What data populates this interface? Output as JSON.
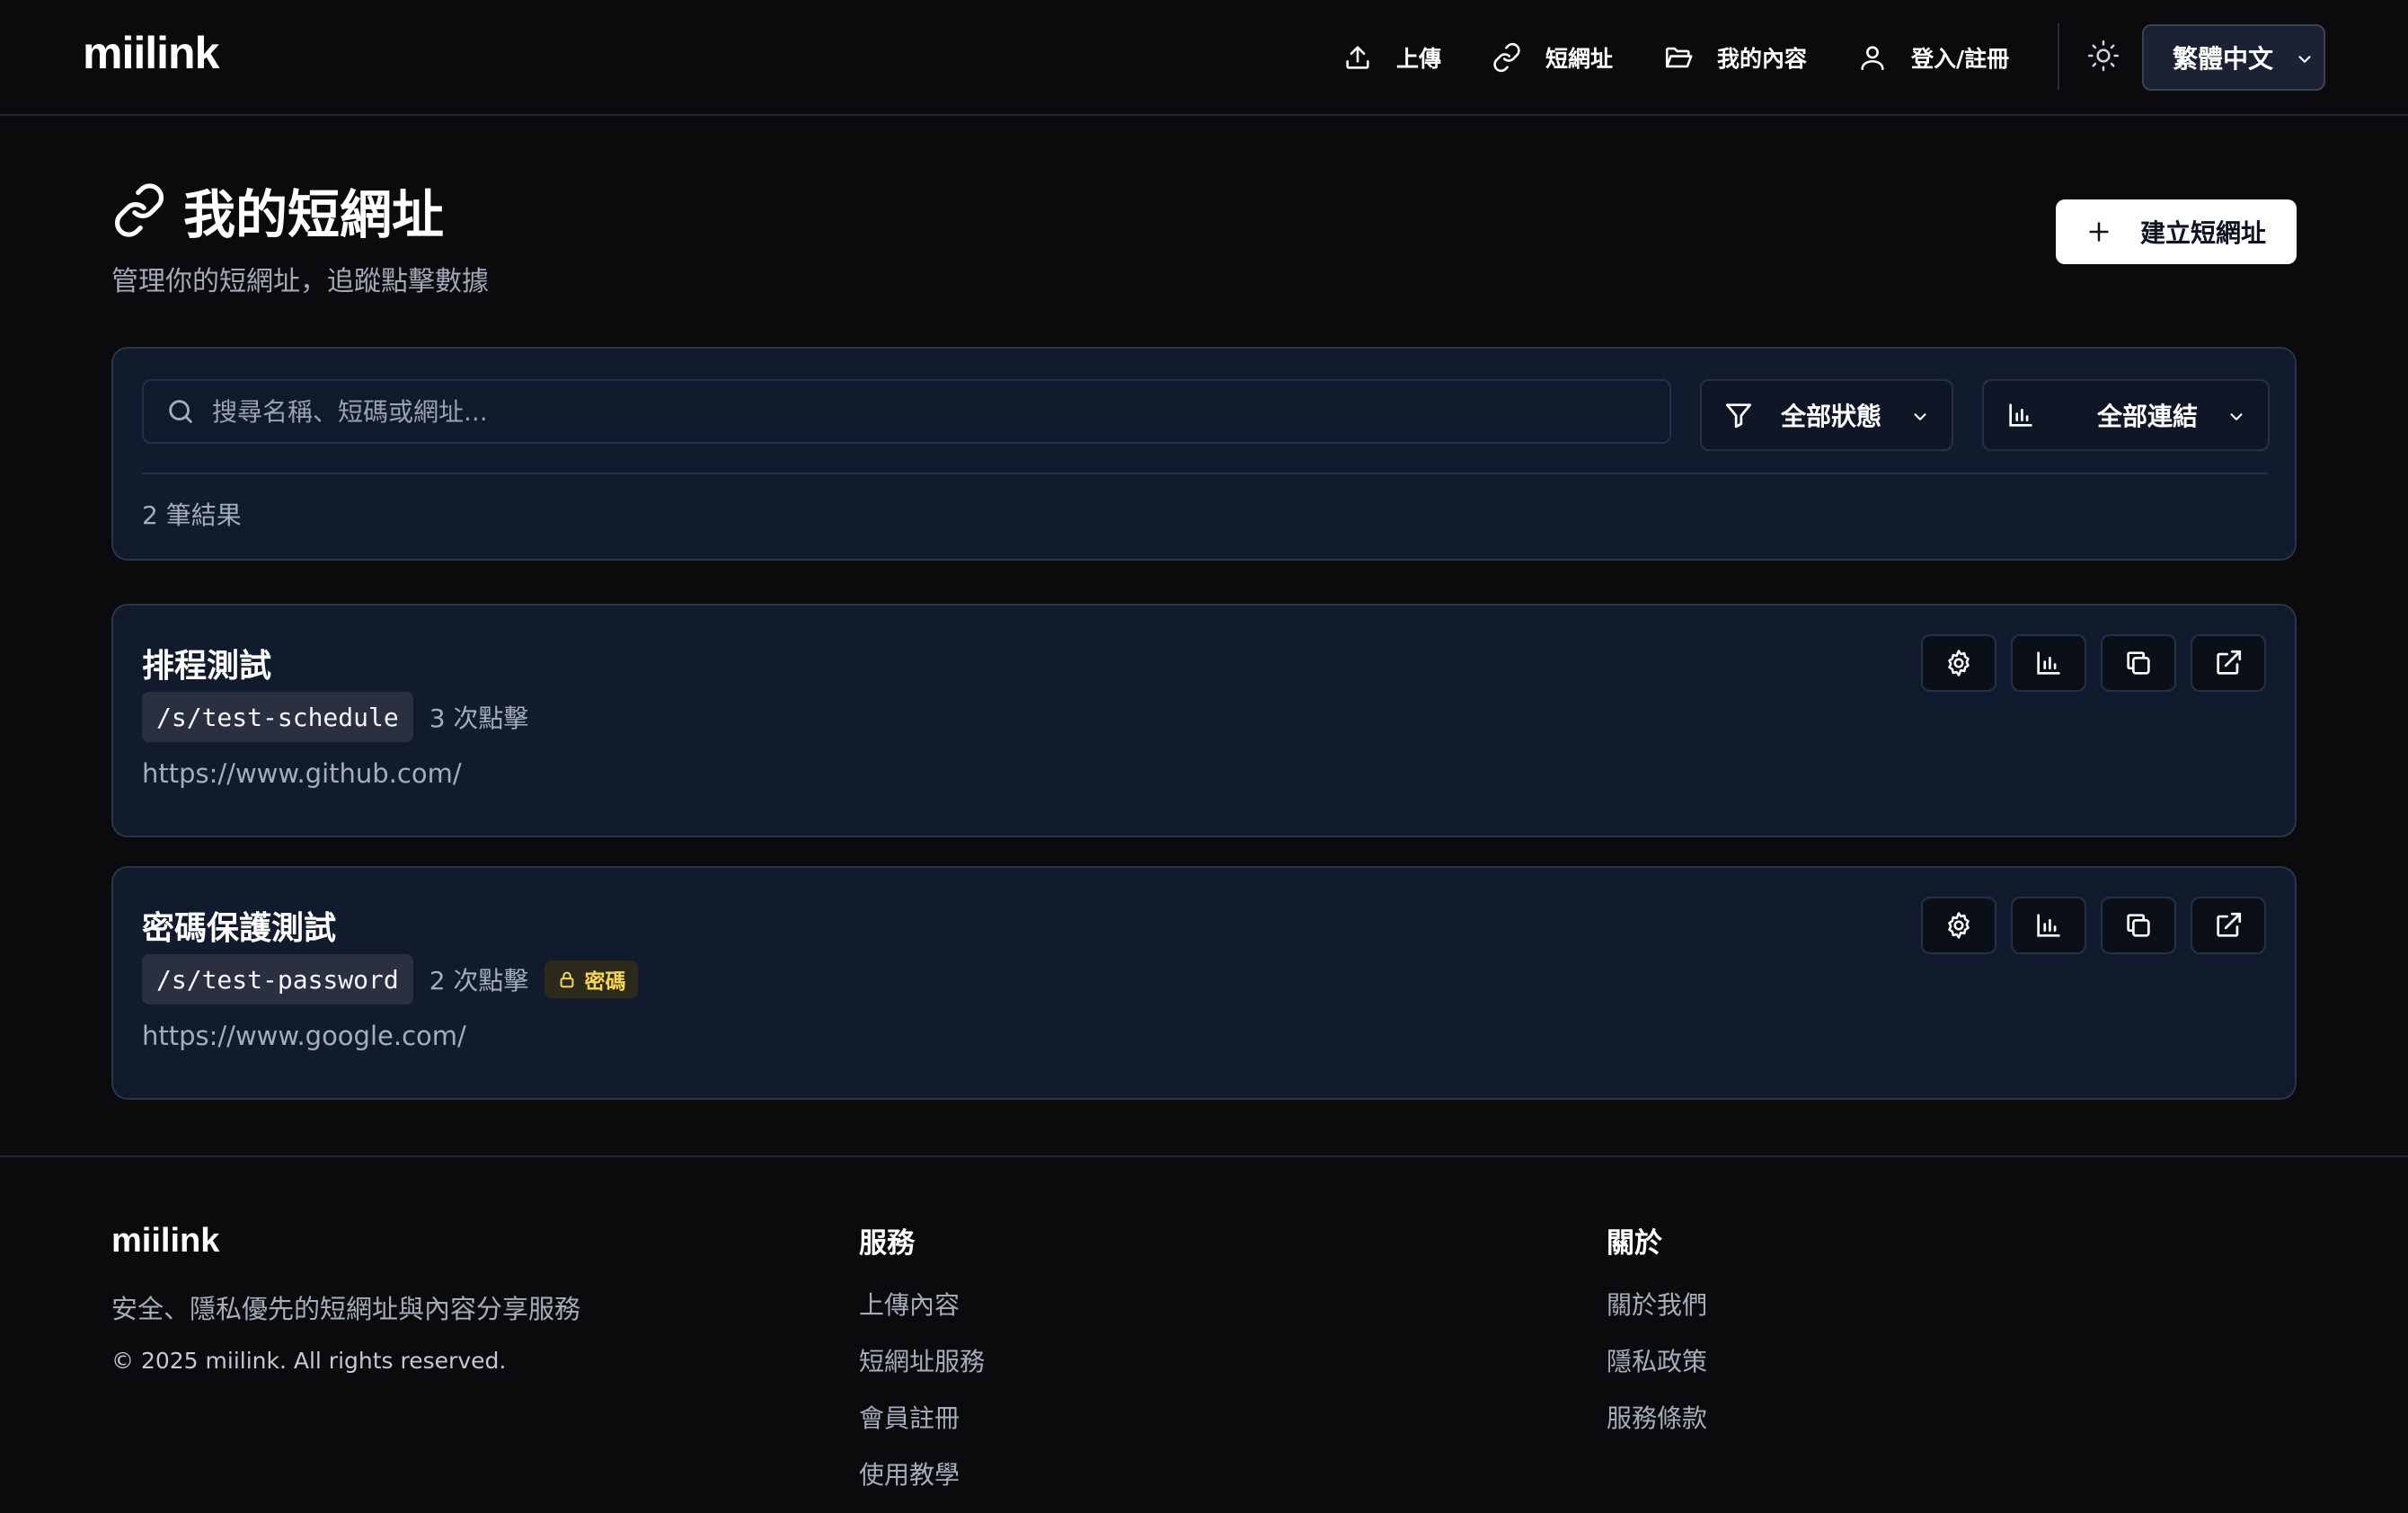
{
  "header": {
    "brand": "miilink",
    "nav": [
      {
        "label": "上傳",
        "icon": "upload-icon"
      },
      {
        "label": "短網址",
        "icon": "link-icon"
      },
      {
        "label": "我的內容",
        "icon": "folder-open-icon"
      },
      {
        "label": "登入/註冊",
        "icon": "user-icon"
      }
    ],
    "theme_icon": "sun-icon",
    "language": "繁體中文"
  },
  "page": {
    "title": "我的短網址",
    "subtitle": "管理你的短網址，追蹤點擊數據",
    "create_button": "建立短網址"
  },
  "filters": {
    "search_placeholder": "搜尋名稱、短碼或網址...",
    "search_value": "",
    "status_filter": "全部狀態",
    "link_filter": "全部連結",
    "result_count": "2 筆結果"
  },
  "links": [
    {
      "name": "排程測試",
      "short_path": "/s/test-schedule",
      "clicks": "3 次點擊",
      "badge": "",
      "url": "https://www.github.com/"
    },
    {
      "name": "密碼保護測試",
      "short_path": "/s/test-password",
      "clicks": "2 次點擊",
      "badge": "密碼",
      "url": "https://www.google.com/"
    }
  ],
  "footer": {
    "brand": "miilink",
    "tagline": "安全、隱私優先的短網址與內容分享服務",
    "copyright": "© 2025 miilink. All rights reserved.",
    "services": {
      "heading": "服務",
      "links": [
        "上傳內容",
        "短網址服務",
        "會員註冊",
        "使用教學"
      ]
    },
    "about": {
      "heading": "關於",
      "links": [
        "關於我們",
        "隱私政策",
        "服務條款"
      ]
    }
  },
  "colors": {
    "background": "#0b0b0d",
    "card": "#111b2e",
    "border": "#2a344a",
    "badge_text": "#f5d651"
  }
}
